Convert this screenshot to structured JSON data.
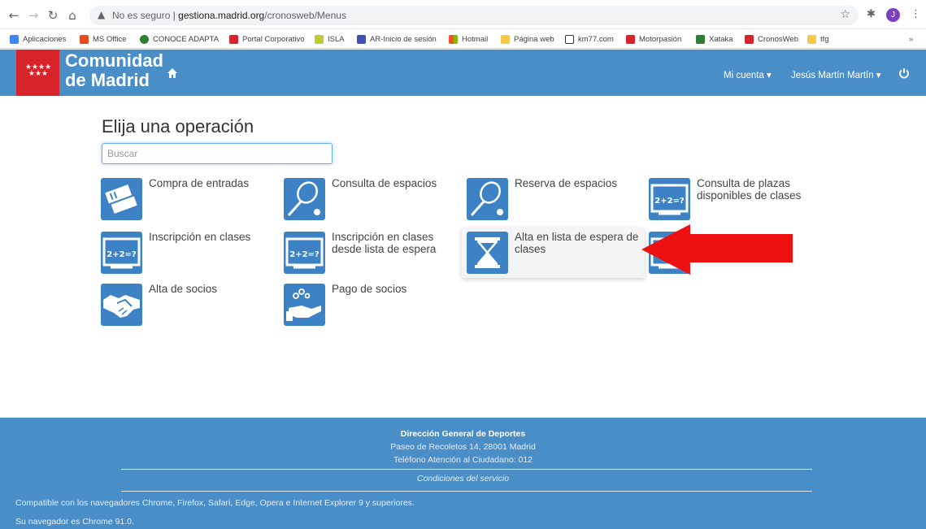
{
  "browser": {
    "security_text": "No es seguro",
    "url_host": "gestiona.madrid.org",
    "url_path": "/cronosweb/Menus",
    "profile_initial": "J",
    "bookmarks": [
      {
        "label": "Aplicaciones",
        "color": "#4285f4"
      },
      {
        "label": "MS Office",
        "color": "#e64a19"
      },
      {
        "label": "CONOCE ADAPTA",
        "color": "#2e7d32"
      },
      {
        "label": "Portal Corporativo",
        "color": "#d8232a"
      },
      {
        "label": "ISLA",
        "color": "#c0ca33"
      },
      {
        "label": "AR-Inicio de sesión",
        "color": "#3f51b5"
      },
      {
        "label": "Hotmail",
        "color": "#f25022"
      },
      {
        "label": "Página web",
        "color": "#f7c948"
      },
      {
        "label": "km77.com",
        "color": "#333333"
      },
      {
        "label": "Motorpasión",
        "color": "#d8232a"
      },
      {
        "label": "Xataka",
        "color": "#2e7d32"
      },
      {
        "label": "CronosWeb",
        "color": "#d8232a"
      },
      {
        "label": "tfg",
        "color": "#f7c948"
      }
    ]
  },
  "header": {
    "logo_line1": "Comunidad",
    "logo_line2": "de Madrid",
    "account_menu": "Mi cuenta ▾",
    "user_menu": "Jesús Martín Martín ▾",
    "brand_color": "#4a8ec8",
    "logo_color": "#d8232a"
  },
  "main": {
    "title": "Elija una operación",
    "search_placeholder": "Buscar",
    "tiles": [
      {
        "label": "Compra de entradas",
        "icon": "ticket-icon"
      },
      {
        "label": "Consulta de espacios",
        "icon": "racket-icon"
      },
      {
        "label": "Reserva de espacios",
        "icon": "racket-icon"
      },
      {
        "label": "Consulta de plazas disponibles de clases",
        "icon": "blackboard-icon"
      },
      {
        "label": "Inscripción en clases",
        "icon": "blackboard-icon"
      },
      {
        "label": "Inscripción en clases desde lista de espera",
        "icon": "blackboard-icon"
      },
      {
        "label": "Alta en lista de espera de clases",
        "icon": "hourglass-icon"
      },
      {
        "label": "",
        "icon": "blackboard-icon"
      },
      {
        "label": "Alta de socios",
        "icon": "handshake-icon"
      },
      {
        "label": "Pago de socios",
        "icon": "coins-hand-icon"
      }
    ]
  },
  "footer": {
    "title": "Dirección General de Deportes",
    "address": "Paseo de Recoletos 14, 28001 Madrid",
    "phone": "Teléfono Atención al Ciudadano: 012",
    "conditions": "Condiciones del servicio",
    "compat": "Compatible con los navegadores Chrome, Firefox, Safari, Edge, Opera e Internet Explorer 9 y superiores.",
    "browser_info": "Su navegador es Chrome 91.0."
  }
}
